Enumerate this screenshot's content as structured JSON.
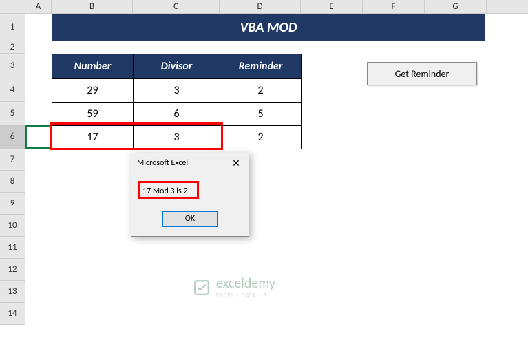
{
  "columns": [
    "A",
    "B",
    "C",
    "D",
    "E",
    "F",
    "G"
  ],
  "rows": [
    "1",
    "2",
    "3",
    "4",
    "5",
    "6",
    "7",
    "8",
    "9",
    "10",
    "11",
    "12",
    "13",
    "14"
  ],
  "title": "VBA MOD",
  "table": {
    "headers": {
      "number": "Number",
      "divisor": "Divisor",
      "reminder": "Reminder"
    },
    "data": [
      {
        "number": "29",
        "divisor": "3",
        "reminder": "2"
      },
      {
        "number": "59",
        "divisor": "6",
        "reminder": "5"
      },
      {
        "number": "17",
        "divisor": "3",
        "reminder": "2"
      }
    ]
  },
  "button": {
    "get_reminder": "Get Reminder"
  },
  "msgbox": {
    "title": "Microsoft Excel",
    "text": "17 Mod 3 is 2",
    "ok": "OK"
  },
  "watermark": {
    "brand": "exceldemy",
    "sub": "EXCEL · DATA · BI"
  }
}
